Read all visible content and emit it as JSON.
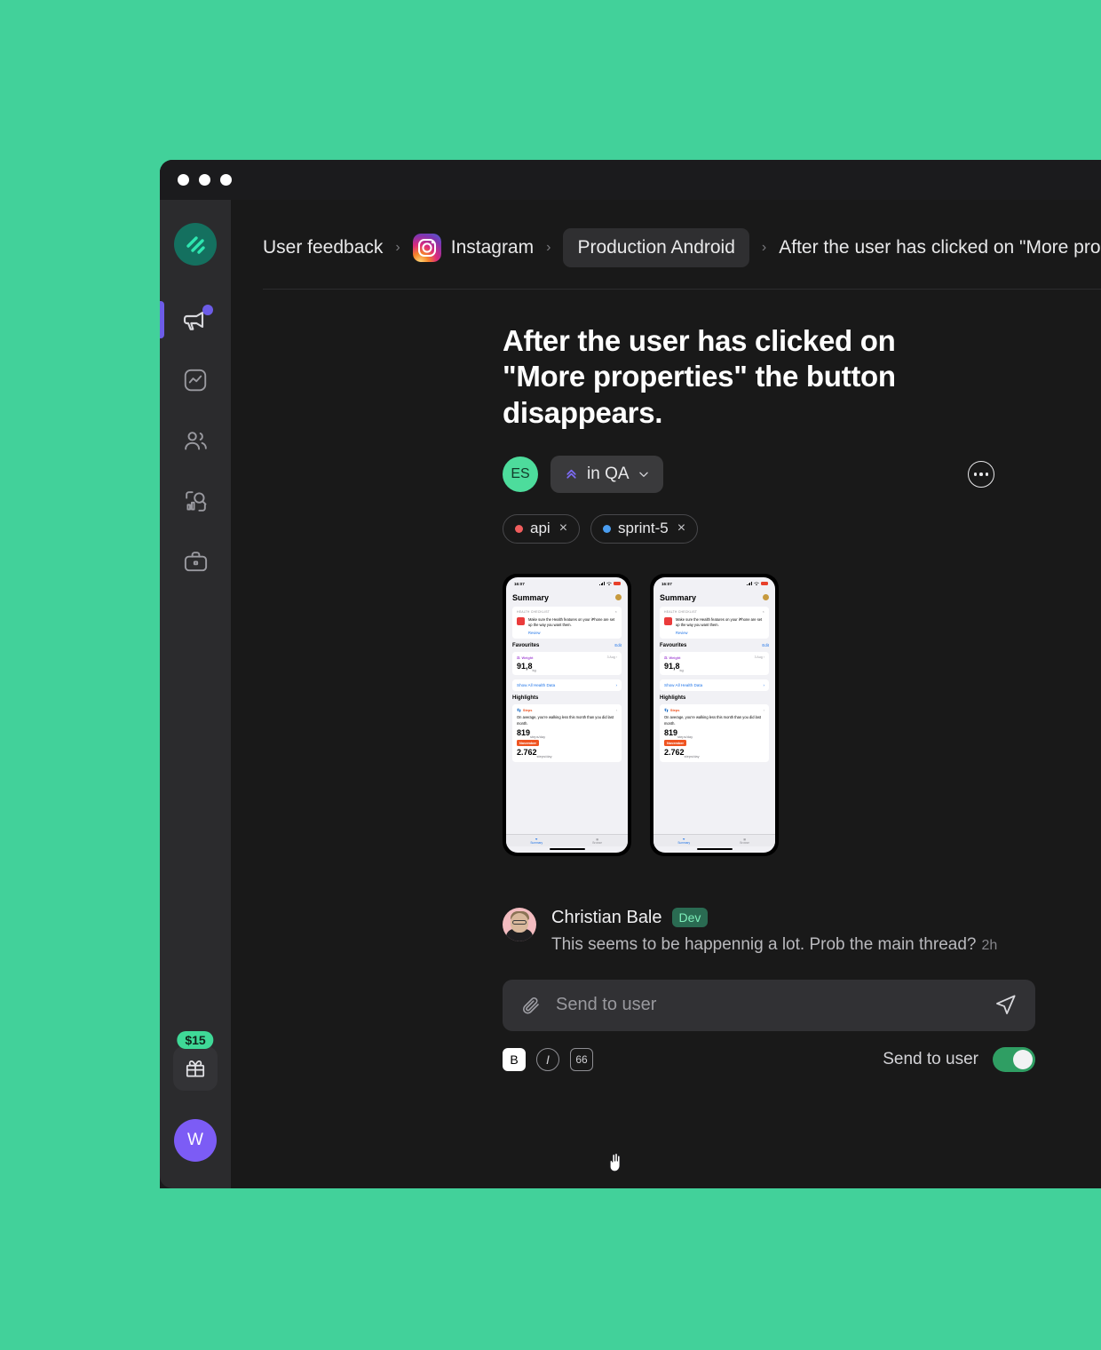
{
  "theme": {
    "background": "#42d19a",
    "window_bg": "#191919",
    "sidebar_bg": "#2b2b2d",
    "accent_purple": "#6c5ce7",
    "accent_green": "#3fd997"
  },
  "window": {
    "traffic_lights": [
      "close-dot",
      "minimize-dot",
      "maximize-dot"
    ]
  },
  "sidebar": {
    "logo_name": "app-logo",
    "items": [
      {
        "name": "megaphone-icon",
        "label": "Feedback",
        "active": true,
        "badge": true
      },
      {
        "name": "trend-icon",
        "label": "Trends",
        "active": false,
        "badge": false
      },
      {
        "name": "users-icon",
        "label": "Users",
        "active": false,
        "badge": false
      },
      {
        "name": "insights-icon",
        "label": "Insights",
        "active": false,
        "badge": false
      },
      {
        "name": "briefcase-icon",
        "label": "Projects",
        "active": false,
        "badge": false
      }
    ],
    "gift": {
      "badge": "$15",
      "icon": "gift-icon"
    },
    "user_avatar": "W"
  },
  "breadcrumb": {
    "items": [
      {
        "label": "User feedback",
        "type": "text"
      },
      {
        "label": "Instagram",
        "type": "icon-text",
        "icon": "instagram-icon"
      },
      {
        "label": "Production Android",
        "type": "pill"
      },
      {
        "label": "After the user has clicked on \"More pro",
        "type": "text"
      }
    ],
    "separator": "›"
  },
  "issue": {
    "title": "After the user has clicked on \"More properties\" the button disappears.",
    "assignee_initials": "ES",
    "status": {
      "label": "in QA",
      "icon": "chevron-up-double-icon",
      "caret": "chevron-down-icon"
    },
    "more_menu": "ellipsis-button",
    "tags": [
      {
        "label": "api",
        "color": "#f05d5d",
        "remove": "×"
      },
      {
        "label": "sprint-5",
        "color": "#4a9df0",
        "remove": "×"
      }
    ]
  },
  "attachments": [
    {
      "name": "health-app-screenshot-1",
      "status_time": "16:07",
      "app_title": "Summary",
      "checklist_header": "HEALTH CHECKLIST",
      "checklist_text": "Make sure the Health features on your iPhone are set up the way you want them.",
      "checklist_link": "Review",
      "favourites_label": "Favourites",
      "favourites_edit": "Edit",
      "weight_label": "Weight",
      "weight_date": "3 Aug",
      "weight_value": "91,8",
      "weight_unit": "kg",
      "show_all": "Show All Health Data",
      "highlights_label": "Highlights",
      "steps_label": "Steps",
      "highlight_text": "On average, you’re walking less this month than you did last month.",
      "value_1": "819",
      "unit_1": "steps/day",
      "month_badge": "November",
      "value_2": "2.762",
      "unit_2": "steps/day",
      "tab_1": "Summary",
      "tab_2": "Browse"
    },
    {
      "name": "health-app-screenshot-2",
      "status_time": "16:07",
      "app_title": "Summary",
      "checklist_header": "HEALTH CHECKLIST",
      "checklist_text": "Make sure the Health features on your iPhone are set up the way you want them.",
      "checklist_link": "Review",
      "favourites_label": "Favourites",
      "favourites_edit": "Edit",
      "weight_label": "Weight",
      "weight_date": "3 Aug",
      "weight_value": "91,8",
      "weight_unit": "kg",
      "show_all": "Show All Health Data",
      "highlights_label": "Highlights",
      "steps_label": "Steps",
      "highlight_text": "On average, you’re walking less this month than you did last month.",
      "value_1": "819",
      "unit_1": "steps/day",
      "month_badge": "November",
      "value_2": "2.762",
      "unit_2": "steps/day",
      "tab_1": "Summary",
      "tab_2": "Browse"
    }
  ],
  "comment": {
    "author": "Christian Bale",
    "role_badge": "Dev",
    "text": "This seems to be happennig a lot. Prob the main thread?",
    "timestamp": "2h"
  },
  "composer": {
    "attach_icon": "paperclip-icon",
    "placeholder": "Send to user",
    "value": "",
    "send_icon": "send-icon",
    "format_buttons": [
      {
        "name": "bold-button",
        "label": "B",
        "active": true
      },
      {
        "name": "italic-button",
        "label": "I",
        "active": false
      },
      {
        "name": "quote-button",
        "label": "66",
        "active": false
      }
    ],
    "toggle_label": "Send to user",
    "toggle_on": true
  }
}
